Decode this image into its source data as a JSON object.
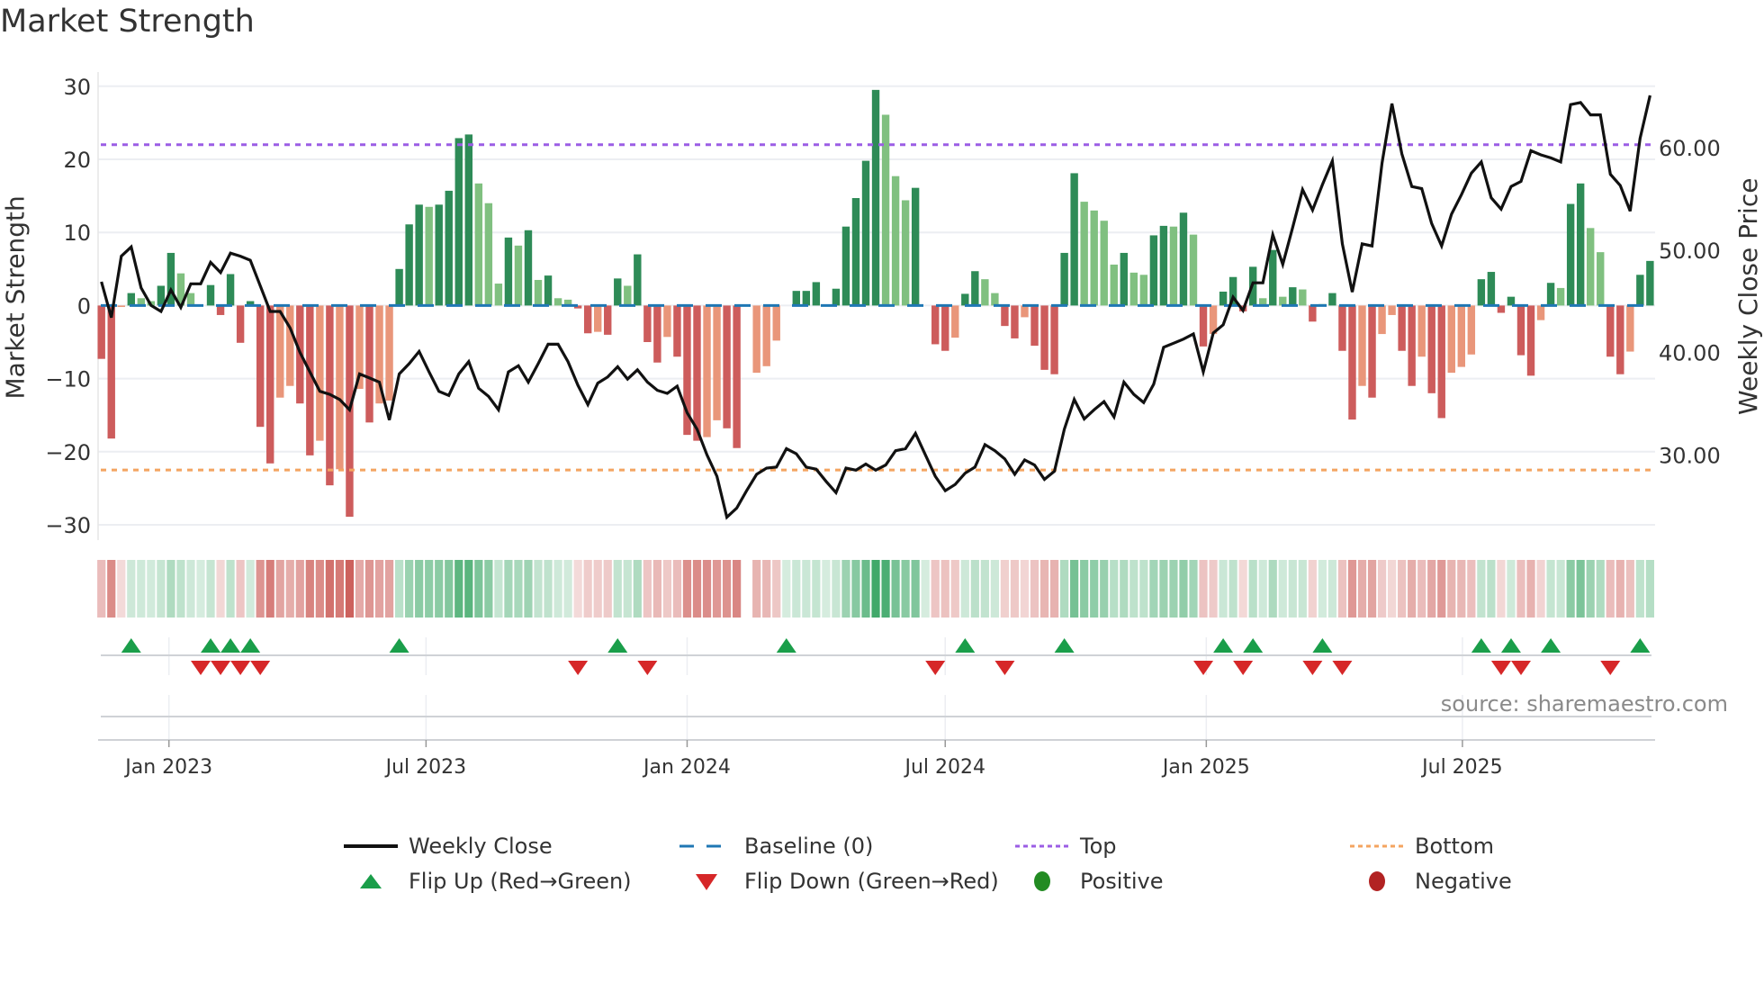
{
  "title": "Market Strength",
  "source": "source: sharemaestro.com",
  "colors": {
    "dark_green": "#2e8b57",
    "light_green": "#80c080",
    "dark_red": "#cd5c5c",
    "salmon": "#e9967a",
    "baseline": "#1f77b4",
    "top": "#9b5de5",
    "bottom": "#f4a460",
    "line": "#111111",
    "flip_up": "#1a9e4a",
    "flip_down": "#d62728",
    "positive": "#228b22",
    "negative": "#b22222"
  },
  "legend": [
    {
      "label": "Weekly Close",
      "icon": "solid-line"
    },
    {
      "label": "Baseline (0)",
      "icon": "dashed-line"
    },
    {
      "label": "Top",
      "icon": "dotted-line-purple"
    },
    {
      "label": "Bottom",
      "icon": "dotted-line-orange"
    },
    {
      "label": "Flip Up (Red→Green)",
      "icon": "triangle-up"
    },
    {
      "label": "Flip Down (Green→Red)",
      "icon": "triangle-down"
    },
    {
      "label": "Positive",
      "icon": "circle-green"
    },
    {
      "label": "Negative",
      "icon": "circle-red"
    }
  ],
  "chart_data": {
    "type": "bar",
    "title": "Market Strength",
    "ylabel": "Market Strength",
    "y2label": "Weekly Close Price",
    "ylim": [
      -31,
      32
    ],
    "y2lim": [
      22,
      67
    ],
    "yticks": [
      30,
      20,
      10,
      0,
      -10,
      -20,
      -30
    ],
    "ytick_labels": [
      "30",
      "20",
      "10",
      "0",
      "−10",
      "−20",
      "−30"
    ],
    "y2ticks": [
      60,
      50,
      40,
      30
    ],
    "y2tick_labels": [
      "60.00",
      "50.00",
      "40.00",
      "30.00"
    ],
    "xlabel": "",
    "x_unit": "week index (weekly bars, Nov 2022 – Nov 2025)",
    "xticks": [
      {
        "label": "Jan 2023",
        "week": 6.8
      },
      {
        "label": "Jul 2023",
        "week": 32.7
      },
      {
        "label": "Jan 2024",
        "week": 59.0
      },
      {
        "label": "Jul 2024",
        "week": 85.0
      },
      {
        "label": "Jan 2025",
        "week": 111.3
      },
      {
        "label": "Jul 2025",
        "week": 137.1
      }
    ],
    "top_level": 22,
    "bottom_level": -22.5,
    "baseline": 0,
    "strength": [
      -7.3,
      -18.2,
      -0.2,
      1.7,
      1.0,
      0.6,
      2.7,
      7.2,
      4.4,
      1.7,
      0,
      2.8,
      -1.3,
      4.3,
      -5.1,
      0.6,
      -16.6,
      -21.6,
      -12.6,
      -11,
      -13.4,
      -20.5,
      -18.5,
      -24.6,
      -22.4,
      -28.9,
      -11.4,
      -16,
      -13.4,
      -13,
      5,
      11.1,
      13.8,
      13.5,
      13.8,
      15.7,
      22.9,
      23.4,
      16.7,
      14,
      3,
      9.3,
      8.2,
      10.3,
      3.5,
      4.1,
      1,
      0.8,
      -0.4,
      -3.8,
      -3.6,
      -4,
      3.7,
      2.7,
      7,
      -5,
      -7.8,
      -4.3,
      -7,
      -17.7,
      -18.5,
      -18,
      -15.7,
      -16.8,
      -19.5,
      0,
      -9.2,
      -8.3,
      -4.8,
      0,
      2,
      2,
      3.2,
      0,
      2.3,
      10.8,
      14.7,
      19.8,
      29.5,
      26.1,
      17.7,
      14.4,
      16.1,
      0,
      -5.3,
      -6.2,
      -4.4,
      1.6,
      4.7,
      3.6,
      1.7,
      -2.8,
      -4.5,
      -1.6,
      -5.5,
      -8.8,
      -9.4,
      7.2,
      18.1,
      14.2,
      13,
      11.6,
      5.6,
      7.2,
      4.5,
      4.2,
      9.6,
      10.9,
      10.8,
      12.7,
      9.7,
      -5.6,
      -3.9,
      1.9,
      3.9,
      -0.8,
      5.3,
      1,
      7.6,
      1.2,
      2.5,
      2.2,
      -2.2,
      0.2,
      1.7,
      -6.2,
      -15.6,
      -11,
      -12.6,
      -3.9,
      -1.3,
      -6.2,
      -11,
      -7,
      -12,
      -15.4,
      -9.2,
      -8.4,
      -6.7,
      3.6,
      4.6,
      -1,
      1.2,
      -6.8,
      -9.6,
      -2,
      3.1,
      2.4,
      13.9,
      16.7,
      10.6,
      7.3,
      -7,
      -9.4,
      -6.3,
      4.2,
      6.1
    ],
    "shade": "RRSDLLDDLLZDRDRDRRSSRRSRSRSRSSDDDLDDDDLLLDLDLDLLRRSRDLDRRSRRRSSRRZSSSZDDDZDDDDDLLLDZRRSDDLLRRSRRRDDLLLLDLLDDLDLRSDDRDLDLDLRLDRRSRSSRRSRRSSSDDRDRRSDLDDLLRRSDD",
    "weekly_close": [
      46.9,
      43.4,
      49.4,
      50.3,
      46.3,
      44.6,
      44.0,
      46.1,
      44.4,
      46.7,
      46.7,
      48.8,
      47.8,
      49.7,
      49.4,
      49.0,
      46.5,
      44.0,
      44.0,
      42.4,
      40.0,
      38.1,
      36.2,
      35.9,
      35.4,
      34.4,
      37.9,
      37.5,
      37.1,
      33.4,
      37.9,
      38.9,
      40.1,
      38.1,
      36.2,
      35.8,
      37.9,
      39.1,
      36.5,
      35.7,
      34.4,
      38.1,
      38.7,
      37.1,
      38.9,
      40.8,
      40.8,
      39.1,
      36.8,
      34.9,
      37.0,
      37.6,
      38.6,
      37.4,
      38.3,
      37.1,
      36.3,
      36.0,
      36.7,
      34.1,
      32.5,
      30.0,
      27.9,
      23.9,
      24.8,
      26.5,
      28.1,
      28.7,
      28.8,
      30.6,
      30.1,
      28.8,
      28.6,
      27.4,
      26.3,
      28.7,
      28.5,
      29.1,
      28.5,
      29.0,
      30.4,
      30.6,
      32.1,
      30.0,
      27.9,
      26.5,
      27.1,
      28.2,
      28.8,
      31.0,
      30.4,
      29.6,
      28.1,
      29.5,
      29.0,
      27.6,
      28.4,
      32.5,
      35.4,
      33.5,
      34.4,
      35.2,
      33.7,
      37.1,
      35.9,
      35.1,
      36.9,
      40.5,
      40.9,
      41.3,
      41.8,
      38.1,
      41.9,
      42.7,
      45.4,
      44.1,
      46.8,
      46.8,
      51.5,
      48.6,
      52.2,
      55.9,
      53.9,
      56.4,
      58.7,
      50.6,
      45.9,
      50.6,
      50.4,
      58.5,
      64.3,
      59.4,
      56.2,
      56.0,
      52.6,
      50.4,
      53.5,
      55.4,
      57.5,
      58.6,
      55.1,
      54.0,
      56.2,
      56.7,
      59.7,
      59.3,
      59.0,
      58.6,
      64.2,
      64.4,
      63.2,
      63.2,
      57.4,
      56.3,
      53.8,
      60.9,
      65.1
    ],
    "flip_up_weeks": [
      3,
      11,
      13,
      15,
      30,
      52,
      69,
      87,
      97,
      113,
      116,
      123,
      139,
      142,
      146,
      155
    ],
    "flip_down_weeks": [
      10,
      12,
      14,
      16,
      48,
      55,
      84,
      91,
      111,
      115,
      122,
      125,
      141,
      143,
      152
    ],
    "legend_position": "bottom",
    "grid": true
  }
}
